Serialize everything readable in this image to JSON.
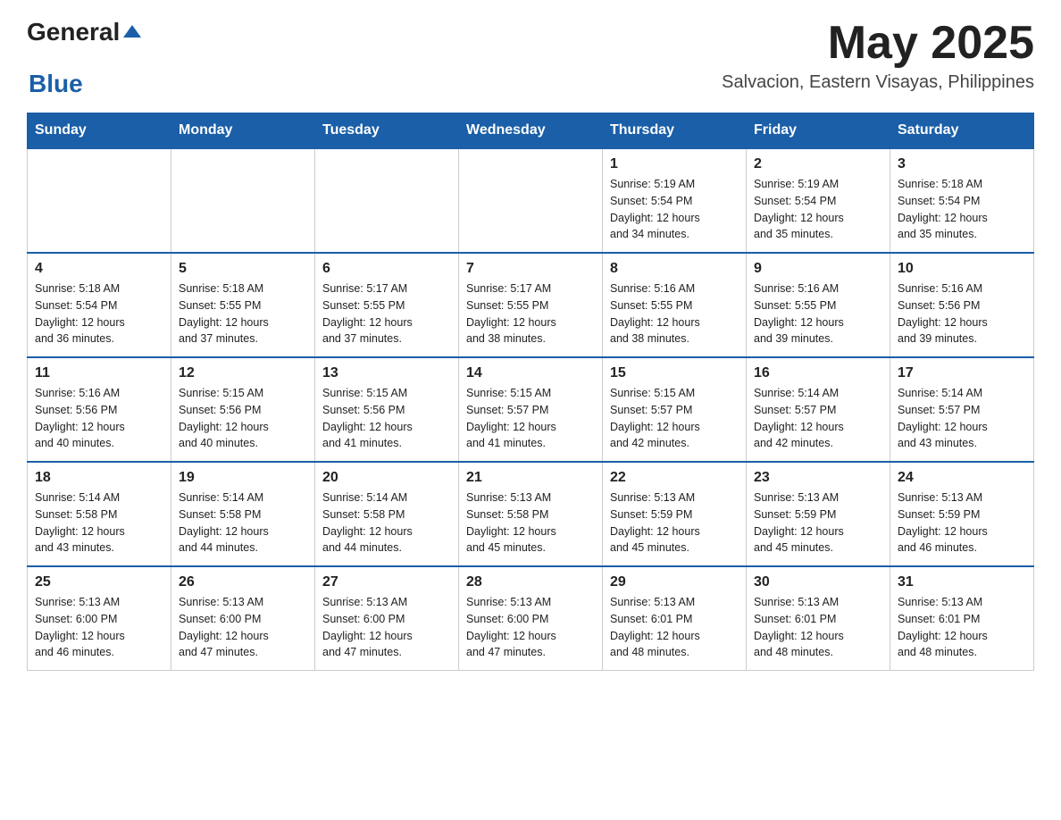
{
  "header": {
    "logo_general": "General",
    "logo_blue": "Blue",
    "month_year": "May 2025",
    "location": "Salvacion, Eastern Visayas, Philippines"
  },
  "days_of_week": [
    "Sunday",
    "Monday",
    "Tuesday",
    "Wednesday",
    "Thursday",
    "Friday",
    "Saturday"
  ],
  "weeks": [
    [
      {
        "day": "",
        "info": ""
      },
      {
        "day": "",
        "info": ""
      },
      {
        "day": "",
        "info": ""
      },
      {
        "day": "",
        "info": ""
      },
      {
        "day": "1",
        "info": "Sunrise: 5:19 AM\nSunset: 5:54 PM\nDaylight: 12 hours\nand 34 minutes."
      },
      {
        "day": "2",
        "info": "Sunrise: 5:19 AM\nSunset: 5:54 PM\nDaylight: 12 hours\nand 35 minutes."
      },
      {
        "day": "3",
        "info": "Sunrise: 5:18 AM\nSunset: 5:54 PM\nDaylight: 12 hours\nand 35 minutes."
      }
    ],
    [
      {
        "day": "4",
        "info": "Sunrise: 5:18 AM\nSunset: 5:54 PM\nDaylight: 12 hours\nand 36 minutes."
      },
      {
        "day": "5",
        "info": "Sunrise: 5:18 AM\nSunset: 5:55 PM\nDaylight: 12 hours\nand 37 minutes."
      },
      {
        "day": "6",
        "info": "Sunrise: 5:17 AM\nSunset: 5:55 PM\nDaylight: 12 hours\nand 37 minutes."
      },
      {
        "day": "7",
        "info": "Sunrise: 5:17 AM\nSunset: 5:55 PM\nDaylight: 12 hours\nand 38 minutes."
      },
      {
        "day": "8",
        "info": "Sunrise: 5:16 AM\nSunset: 5:55 PM\nDaylight: 12 hours\nand 38 minutes."
      },
      {
        "day": "9",
        "info": "Sunrise: 5:16 AM\nSunset: 5:55 PM\nDaylight: 12 hours\nand 39 minutes."
      },
      {
        "day": "10",
        "info": "Sunrise: 5:16 AM\nSunset: 5:56 PM\nDaylight: 12 hours\nand 39 minutes."
      }
    ],
    [
      {
        "day": "11",
        "info": "Sunrise: 5:16 AM\nSunset: 5:56 PM\nDaylight: 12 hours\nand 40 minutes."
      },
      {
        "day": "12",
        "info": "Sunrise: 5:15 AM\nSunset: 5:56 PM\nDaylight: 12 hours\nand 40 minutes."
      },
      {
        "day": "13",
        "info": "Sunrise: 5:15 AM\nSunset: 5:56 PM\nDaylight: 12 hours\nand 41 minutes."
      },
      {
        "day": "14",
        "info": "Sunrise: 5:15 AM\nSunset: 5:57 PM\nDaylight: 12 hours\nand 41 minutes."
      },
      {
        "day": "15",
        "info": "Sunrise: 5:15 AM\nSunset: 5:57 PM\nDaylight: 12 hours\nand 42 minutes."
      },
      {
        "day": "16",
        "info": "Sunrise: 5:14 AM\nSunset: 5:57 PM\nDaylight: 12 hours\nand 42 minutes."
      },
      {
        "day": "17",
        "info": "Sunrise: 5:14 AM\nSunset: 5:57 PM\nDaylight: 12 hours\nand 43 minutes."
      }
    ],
    [
      {
        "day": "18",
        "info": "Sunrise: 5:14 AM\nSunset: 5:58 PM\nDaylight: 12 hours\nand 43 minutes."
      },
      {
        "day": "19",
        "info": "Sunrise: 5:14 AM\nSunset: 5:58 PM\nDaylight: 12 hours\nand 44 minutes."
      },
      {
        "day": "20",
        "info": "Sunrise: 5:14 AM\nSunset: 5:58 PM\nDaylight: 12 hours\nand 44 minutes."
      },
      {
        "day": "21",
        "info": "Sunrise: 5:13 AM\nSunset: 5:58 PM\nDaylight: 12 hours\nand 45 minutes."
      },
      {
        "day": "22",
        "info": "Sunrise: 5:13 AM\nSunset: 5:59 PM\nDaylight: 12 hours\nand 45 minutes."
      },
      {
        "day": "23",
        "info": "Sunrise: 5:13 AM\nSunset: 5:59 PM\nDaylight: 12 hours\nand 45 minutes."
      },
      {
        "day": "24",
        "info": "Sunrise: 5:13 AM\nSunset: 5:59 PM\nDaylight: 12 hours\nand 46 minutes."
      }
    ],
    [
      {
        "day": "25",
        "info": "Sunrise: 5:13 AM\nSunset: 6:00 PM\nDaylight: 12 hours\nand 46 minutes."
      },
      {
        "day": "26",
        "info": "Sunrise: 5:13 AM\nSunset: 6:00 PM\nDaylight: 12 hours\nand 47 minutes."
      },
      {
        "day": "27",
        "info": "Sunrise: 5:13 AM\nSunset: 6:00 PM\nDaylight: 12 hours\nand 47 minutes."
      },
      {
        "day": "28",
        "info": "Sunrise: 5:13 AM\nSunset: 6:00 PM\nDaylight: 12 hours\nand 47 minutes."
      },
      {
        "day": "29",
        "info": "Sunrise: 5:13 AM\nSunset: 6:01 PM\nDaylight: 12 hours\nand 48 minutes."
      },
      {
        "day": "30",
        "info": "Sunrise: 5:13 AM\nSunset: 6:01 PM\nDaylight: 12 hours\nand 48 minutes."
      },
      {
        "day": "31",
        "info": "Sunrise: 5:13 AM\nSunset: 6:01 PM\nDaylight: 12 hours\nand 48 minutes."
      }
    ]
  ]
}
